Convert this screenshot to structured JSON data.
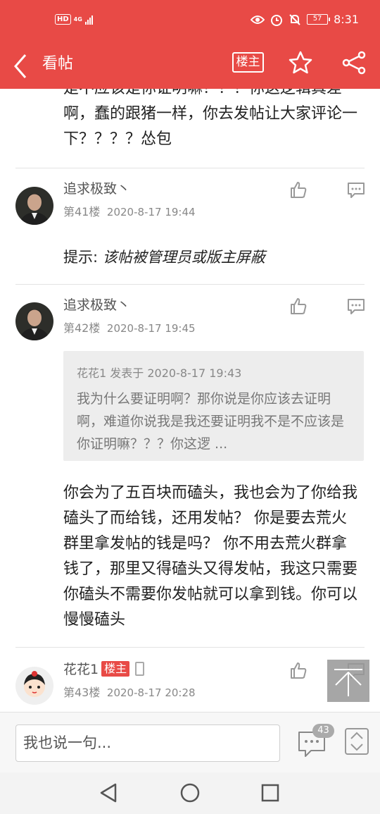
{
  "status_bar": {
    "hd": "HD",
    "network": "4G",
    "battery": "57",
    "time": "8:31"
  },
  "header": {
    "title": "看帖",
    "owner_label": "楼主"
  },
  "thread": {
    "top_text": "是不应该是你证明嘛？？？你这逻辑真差啊，蠢的跟猪一样，你去发帖让大家评论一下？？？？怂包",
    "posts": [
      {
        "username": "追求极致丶",
        "floor": "第41楼",
        "time": "2020-8-17 19:44",
        "hint_label": "提示: ",
        "hint_text": "该帖被管理员或版主屏蔽"
      },
      {
        "username": "追求极致丶",
        "floor": "第42楼",
        "time": "2020-8-17 19:45",
        "quote_head": "花花1 发表于 2020-8-17 19:43",
        "quote_body": "我为什么要证明啊？那你说是你应该去证明啊，难道你说我是我还要证明我不是不应该是你证明嘛？？？你这逻 ...",
        "body": "你会为了五百块而磕头，我也会为了你给我磕头了而给钱，还用发帖？ 你是要去荒火群里拿发帖的钱是吗？ 你不用去荒火群拿钱了，那里又得磕头又得发帖，我这只需要你磕头不需要你发帖就可以拿到钱。你可以慢慢磕头"
      },
      {
        "username": "花花1",
        "badge": "楼主",
        "floor": "第43楼",
        "time": "2020-8-17 20:28"
      }
    ]
  },
  "reply_bar": {
    "placeholder": "我也说一句...",
    "comment_count": "43"
  },
  "colors": {
    "brand": "#e84a46",
    "divider": "#e3e3e3",
    "quote_bg": "#ededed"
  }
}
